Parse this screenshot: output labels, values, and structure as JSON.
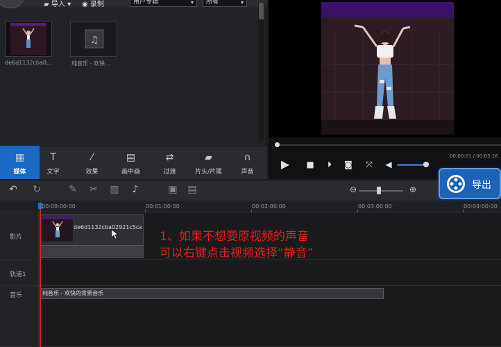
{
  "library": {
    "import_label": "导入",
    "record_label": "录制",
    "album_select": "用户专辑",
    "filter_select": "所有",
    "items": [
      {
        "caption": "de6d1132cba0..."
      },
      {
        "caption": "纯音乐 - 欢快..."
      }
    ]
  },
  "preview": {
    "time_text": "00:00:01 / 00:03:16"
  },
  "tabs": [
    {
      "label": "媒体",
      "icon": "media-icon",
      "active": true
    },
    {
      "label": "文字",
      "icon": "text-icon"
    },
    {
      "label": "效果",
      "icon": "effects-wand-icon"
    },
    {
      "label": "画中画",
      "icon": "pip-icon"
    },
    {
      "label": "过渡",
      "icon": "transition-icon"
    },
    {
      "label": "片头/片尾",
      "icon": "clapper-icon"
    },
    {
      "label": "声音",
      "icon": "headphones-icon"
    }
  ],
  "export": {
    "label": "导出"
  },
  "ruler": {
    "ticks": [
      "00:00:00:00",
      "00:01:00:00",
      "00:02:00:00",
      "00:03:00:00",
      "00:04:00:00"
    ]
  },
  "tracks": {
    "video_label": "影片",
    "track1_label": "轨道1",
    "music_label": "音乐",
    "video_clip_name": "de6d1132cba02921c5ca...",
    "music_clip_name": "纯音乐 - 欢快的背景音乐"
  },
  "annotation": {
    "line1": "1、如果不想要原视频的声音",
    "line2": "可以右键点击视频选择“静音”"
  },
  "colors": {
    "accent": "#1b68c5",
    "annotation": "#e81d1d",
    "playhead": "#d61f1f"
  }
}
